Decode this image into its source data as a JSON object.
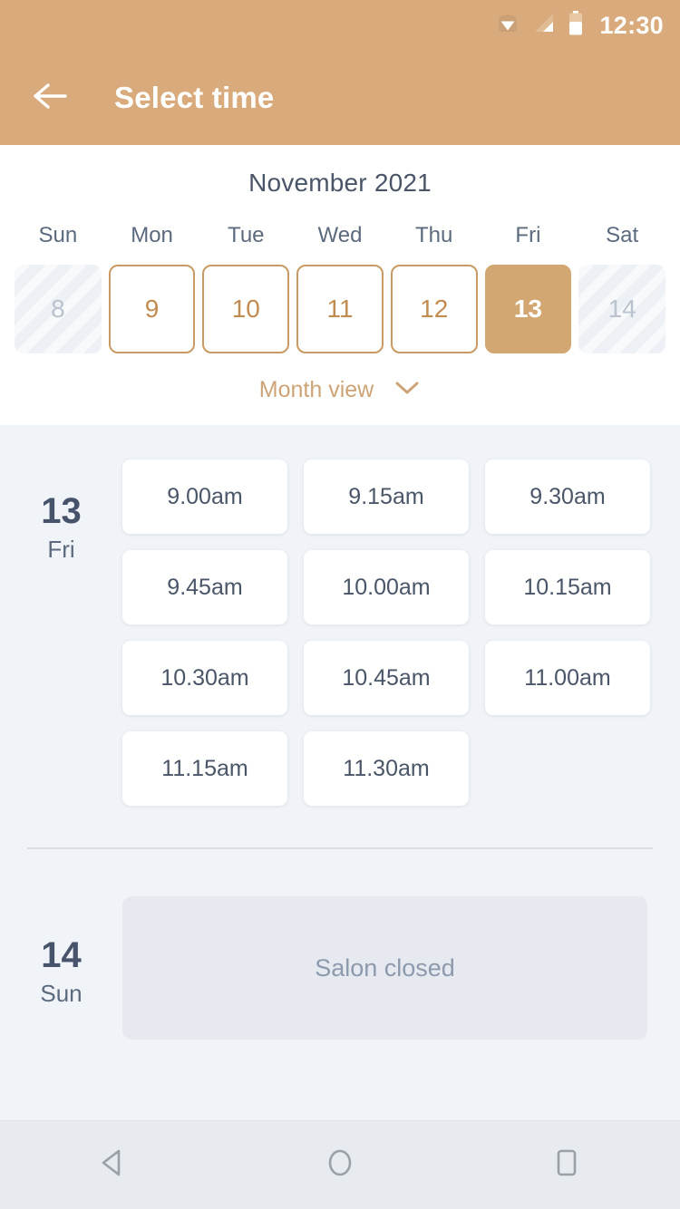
{
  "status_bar": {
    "time": "12:30",
    "icons": [
      "wifi-icon",
      "signal-icon",
      "battery-icon"
    ]
  },
  "app_bar": {
    "back_icon": "arrow-left-icon",
    "title": "Select time"
  },
  "calendar": {
    "month_title": "November 2021",
    "weekdays": [
      "Sun",
      "Mon",
      "Tue",
      "Wed",
      "Thu",
      "Fri",
      "Sat"
    ],
    "days": [
      {
        "number": "8",
        "state": "disabled"
      },
      {
        "number": "9",
        "state": "available"
      },
      {
        "number": "10",
        "state": "available"
      },
      {
        "number": "11",
        "state": "available"
      },
      {
        "number": "12",
        "state": "available"
      },
      {
        "number": "13",
        "state": "selected"
      },
      {
        "number": "14",
        "state": "disabled"
      }
    ],
    "month_view_label": "Month view",
    "month_view_icon": "chevron-down-icon"
  },
  "schedule": [
    {
      "day_number": "13",
      "day_name": "Fri",
      "status": "open",
      "slots": [
        "9.00am",
        "9.15am",
        "9.30am",
        "9.45am",
        "10.00am",
        "10.15am",
        "10.30am",
        "10.45am",
        "11.00am",
        "11.15am",
        "11.30am"
      ]
    },
    {
      "day_number": "14",
      "day_name": "Sun",
      "status": "closed",
      "closed_message": "Salon closed"
    }
  ],
  "nav_bar": {
    "back": "nav-back-icon",
    "home": "nav-home-icon",
    "recents": "nav-recents-icon"
  },
  "colors": {
    "accent": "#d3a771",
    "header": "#d9ab7c",
    "slot_bg": "#ffffff",
    "page_bg": "#f0f3f8",
    "text_dark": "#46536b",
    "text_muted": "#8d99ac"
  }
}
